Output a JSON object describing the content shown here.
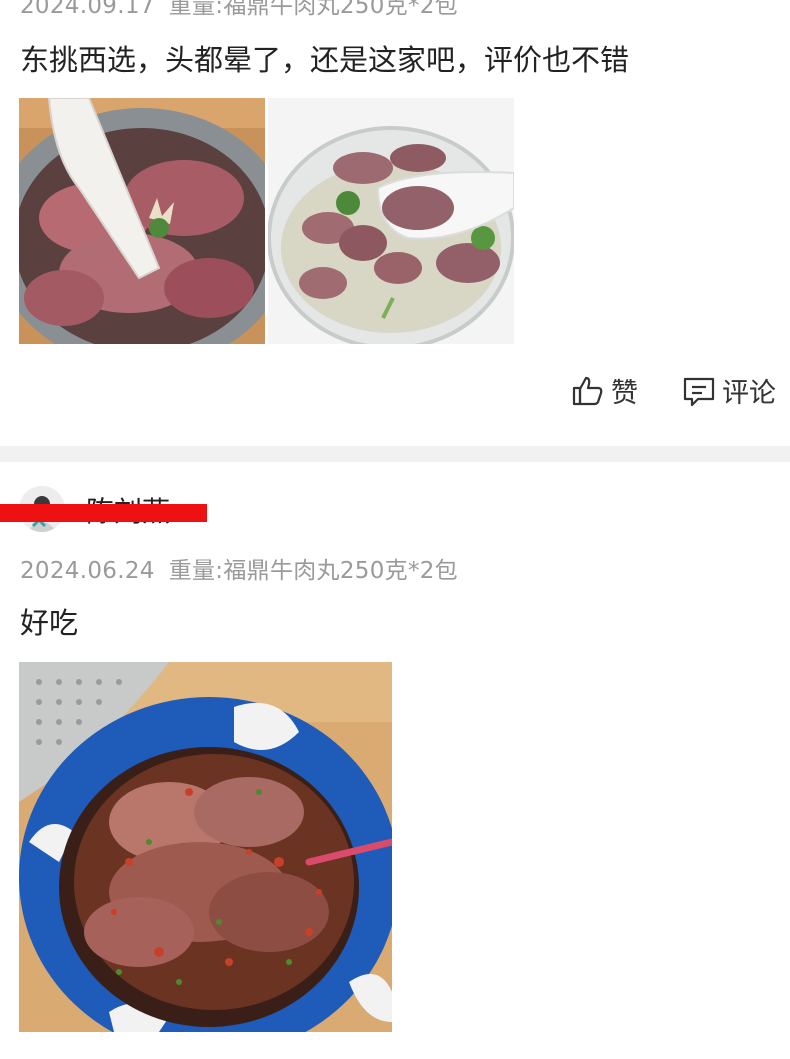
{
  "reviews": [
    {
      "date": "2024.09.17",
      "spec": "重量:福鼎牛肉丸250克*2包",
      "text": "东挑西选，头都晕了，还是这家吧，评价也不错",
      "photos": [
        "beef-slices-in-steel-bowl",
        "beef-balls-soup-in-glass-bowl"
      ],
      "actions": {
        "like_label": "赞",
        "comment_label": "评论"
      }
    },
    {
      "username": "陈刘燕",
      "date": "2024.06.24",
      "spec": "重量:福鼎牛肉丸250克*2包",
      "text": "好吃",
      "photos": [
        "spicy-beef-ball-soup-in-blue-bowl"
      ]
    }
  ],
  "colors": {
    "meta_gray": "#9a9a9a",
    "divider": "#f1f1f1",
    "redaction": "#ee1111"
  },
  "icons": {
    "like": "thumbs-up-icon",
    "comment": "comment-icon"
  }
}
